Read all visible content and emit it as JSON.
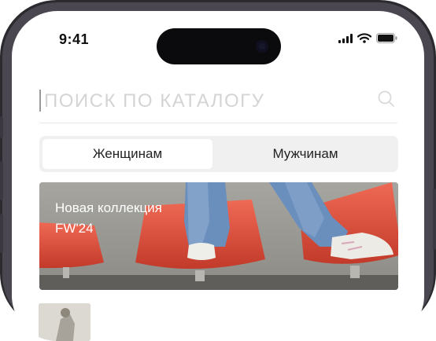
{
  "status_bar": {
    "time": "9:41",
    "icons": [
      "cellular-signal-icon",
      "wifi-icon",
      "battery-icon"
    ]
  },
  "search": {
    "placeholder": "ПОИСК ПО КАТАЛОГУ",
    "value": "",
    "icon": "search-icon"
  },
  "tabs": [
    {
      "label": "Женщинам",
      "active": true
    },
    {
      "label": "Мужчинам",
      "active": false
    }
  ],
  "banner": {
    "title_line1": "Новая коллекция",
    "title_line2": "FW'24"
  },
  "colors": {
    "accent_chair": "#e2523f",
    "tab_bg": "#f0f0f0",
    "placeholder": "#d4d4d4"
  }
}
